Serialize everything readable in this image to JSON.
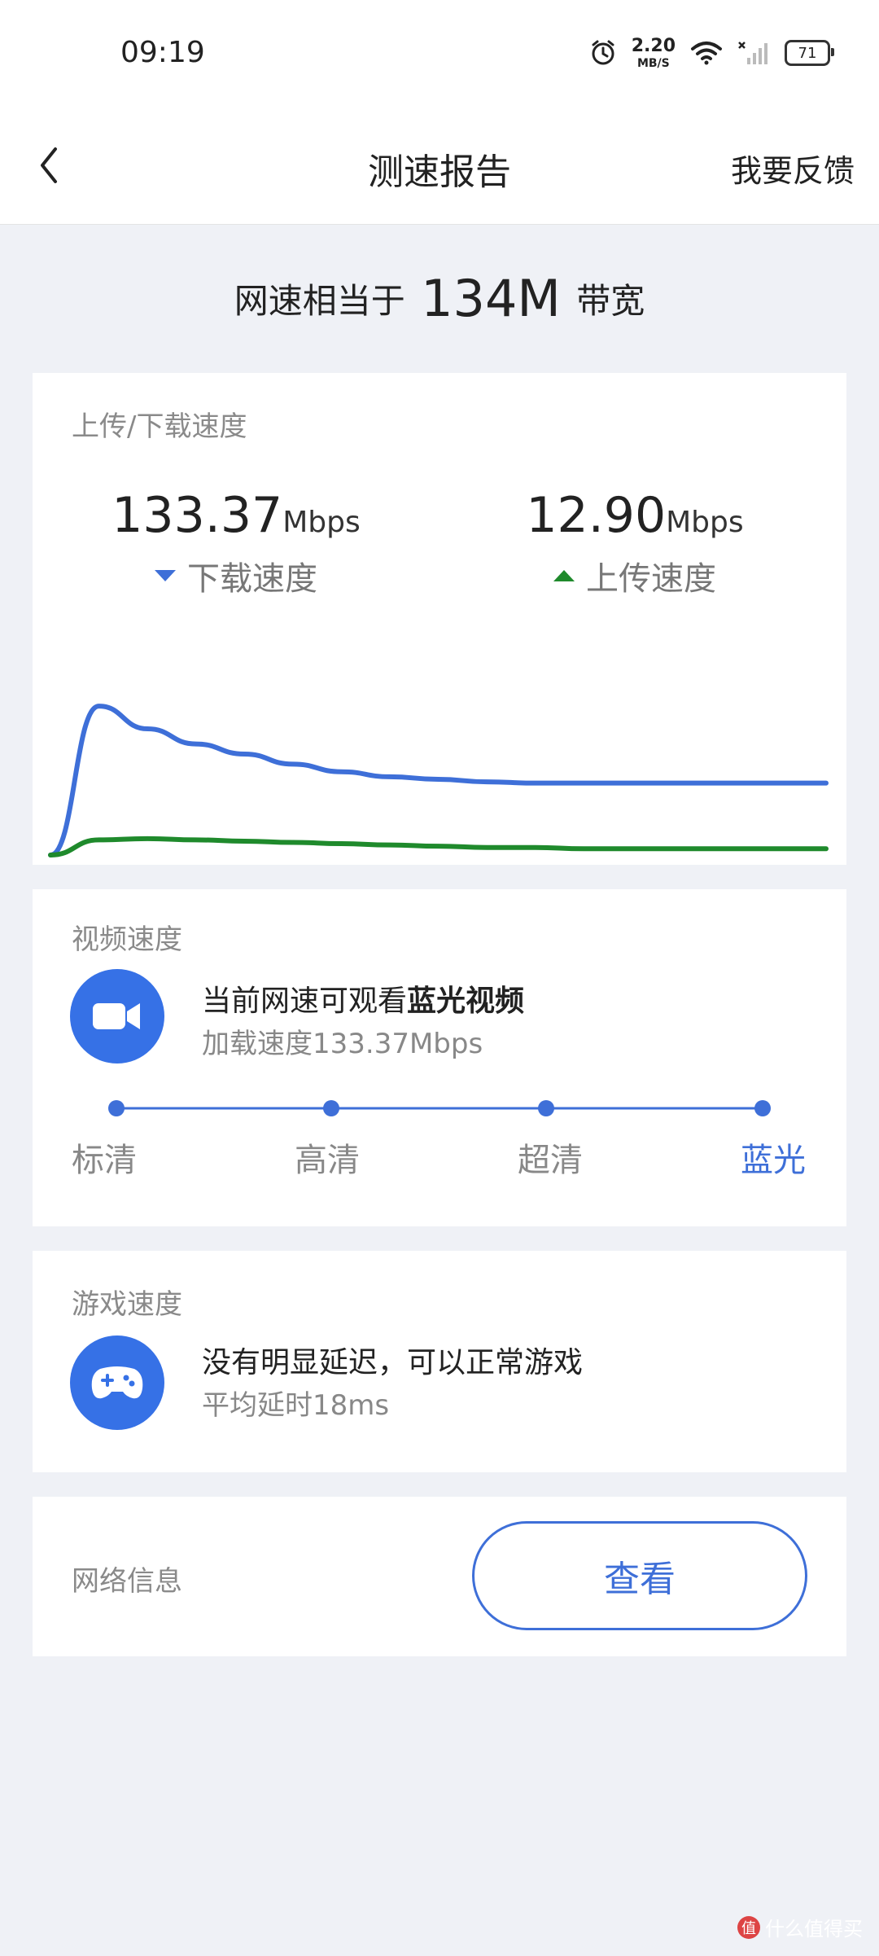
{
  "status_bar": {
    "time": "09:19",
    "net_speed_value": "2.20",
    "net_speed_unit": "MB/S",
    "battery": "71",
    "icons": [
      "alarm-icon",
      "wifi-icon",
      "signal-icon",
      "battery-icon"
    ]
  },
  "nav": {
    "back_icon": "chevron-left-icon",
    "title": "测速报告",
    "feedback": "我要反馈"
  },
  "headline": {
    "prefix": "网速相当于",
    "value": "134M",
    "suffix": "带宽"
  },
  "speed_card": {
    "label": "上传/下载速度",
    "download": {
      "value": "133.37",
      "unit": "Mbps",
      "caption": "下载速度"
    },
    "upload": {
      "value": "12.90",
      "unit": "Mbps",
      "caption": "上传速度"
    }
  },
  "chart_data": {
    "type": "line",
    "series": [
      {
        "color": "#3e6fd8",
        "values": [
          0,
          118,
          100,
          88,
          80,
          72,
          66,
          62,
          60,
          58,
          57,
          57,
          57,
          57,
          57,
          57,
          57
        ]
      },
      {
        "color": "#1f8a2c",
        "values": [
          0,
          12,
          13,
          12,
          11,
          10,
          9,
          8,
          7,
          6,
          6,
          5,
          5,
          5,
          5,
          5,
          5
        ]
      }
    ]
  },
  "video_card": {
    "label": "视频速度",
    "icon": "video-camera-icon",
    "main_prefix": "当前网速可观看",
    "main_bold": "蓝光视频",
    "sub": "加载速度133.37Mbps",
    "levels": [
      "标清",
      "高清",
      "超清",
      "蓝光"
    ],
    "active_level": 3,
    "accent": "#3e6fd8"
  },
  "game_card": {
    "label": "游戏速度",
    "icon": "gamepad-icon",
    "main": "没有明显延迟，可以正常游戏",
    "sub": "平均延时18ms"
  },
  "network_card": {
    "label": "网络信息",
    "button": "查看"
  },
  "watermark": {
    "logo": "值",
    "text": "什么值得买"
  }
}
